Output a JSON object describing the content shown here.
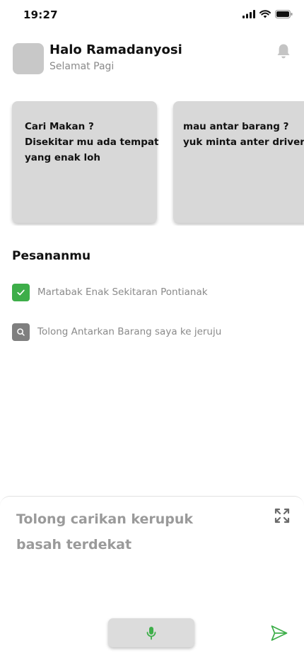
{
  "status_bar": {
    "time": "19:27"
  },
  "header": {
    "greeting": "Halo Ramadanyosi",
    "subtitle": "Selamat Pagi"
  },
  "cards": [
    {
      "text": "Cari Makan ?\nDisekitar mu ada tempat\nyang enak loh"
    },
    {
      "text": "mau antar barang ?\nyuk minta anter driver k"
    }
  ],
  "orders": {
    "title": "Pesananmu",
    "items": [
      {
        "label": "Martabak Enak Sekitaran Pontianak",
        "status": "done",
        "icon": "check-icon"
      },
      {
        "label": "Tolong Antarkan Barang saya ke jeruju",
        "status": "searching",
        "icon": "search-icon"
      }
    ]
  },
  "composer": {
    "text": "Tolong carikan kerupuk basah terdekat"
  },
  "colors": {
    "accent_green": "#3dae49",
    "card_bg": "#d8d8d8",
    "muted_text": "#8a8a8a"
  }
}
